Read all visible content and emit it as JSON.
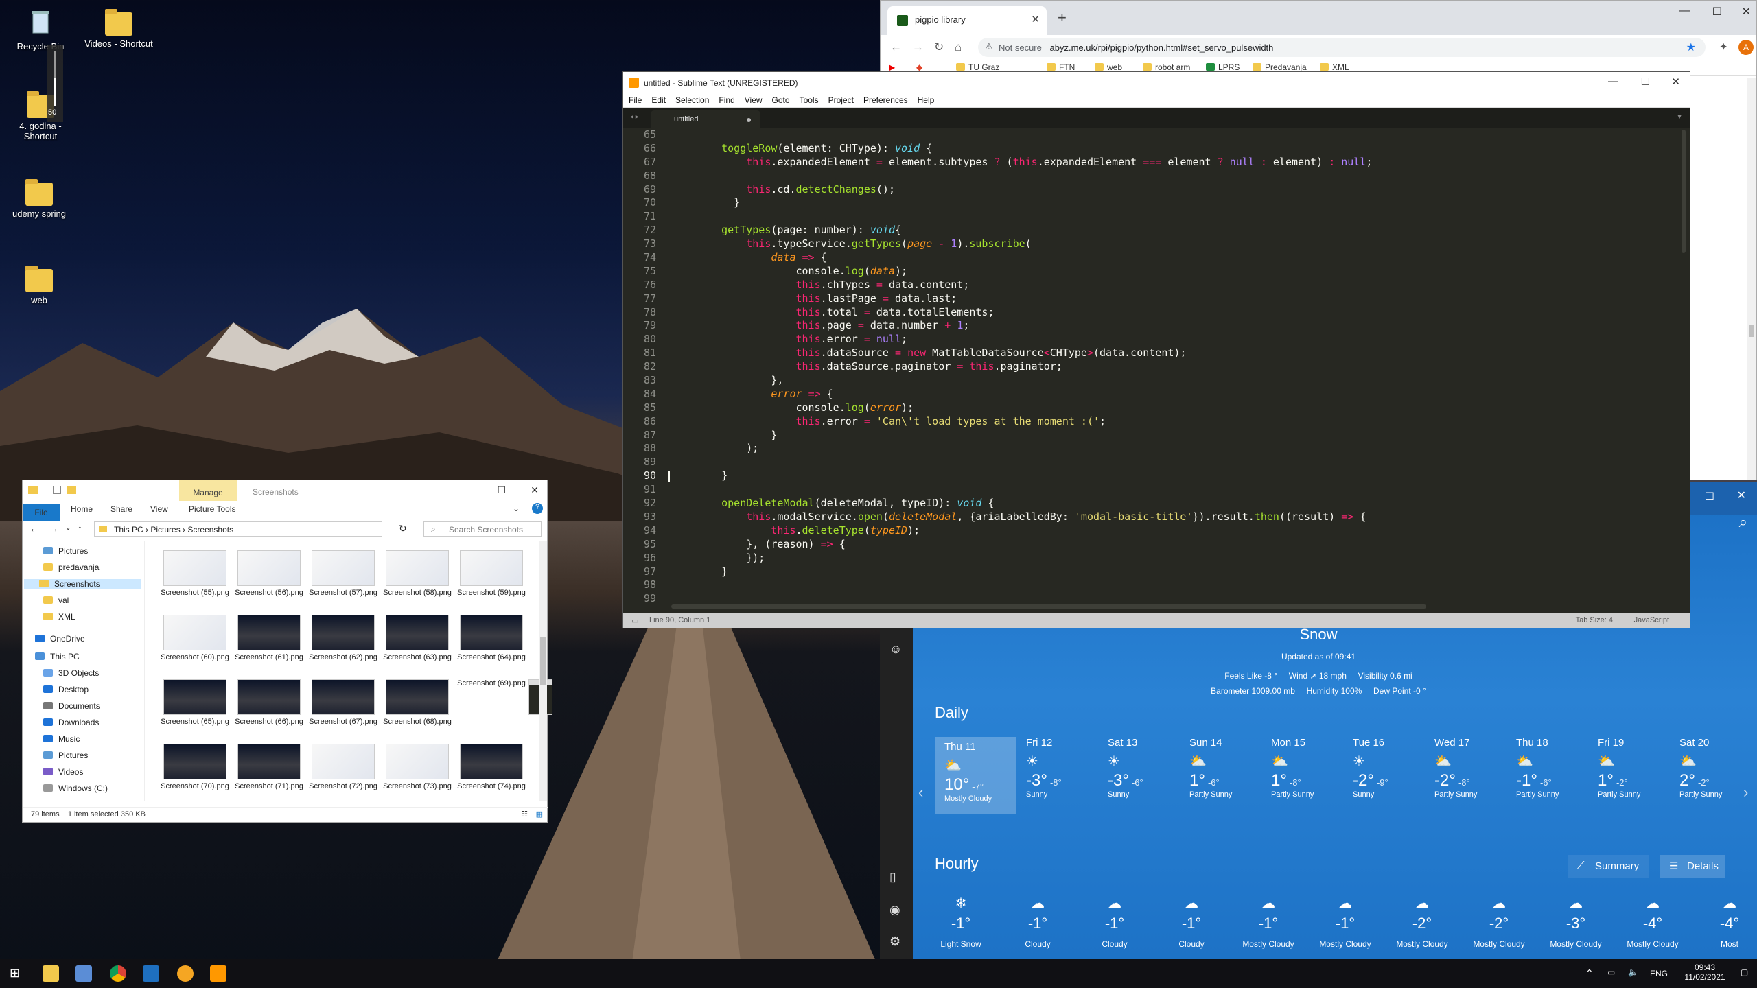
{
  "desktop": {
    "icons": [
      {
        "label": "Recycle Bin"
      },
      {
        "label": "Videos - Shortcut"
      },
      {
        "label": "4. godina - Shortcut"
      },
      {
        "label": "udemy spring"
      },
      {
        "label": "web"
      }
    ],
    "volume_level": "50"
  },
  "chrome": {
    "tab_title": "pigpio library",
    "url_prefix": "Not secure",
    "url": "abyz.me.uk/rpi/pigpio/python.html#set_servo_pulsewidth",
    "profile_initial": "A",
    "bookmarks": [
      "TU Graz",
      "FTN",
      "web",
      "robot arm",
      "LPRS",
      "Predavanja",
      "XML"
    ]
  },
  "sublime": {
    "window_title": "untitled - Sublime Text (UNREGISTERED)",
    "menu": [
      "File",
      "Edit",
      "Selection",
      "Find",
      "View",
      "Goto",
      "Tools",
      "Project",
      "Preferences",
      "Help"
    ],
    "tab_name": "untitled",
    "line_numbers": [
      "65",
      "66",
      "67",
      "68",
      "69",
      "70",
      "71",
      "72",
      "73",
      "74",
      "75",
      "76",
      "77",
      "78",
      "79",
      "80",
      "81",
      "82",
      "83",
      "84",
      "85",
      "86",
      "87",
      "88",
      "89",
      "90",
      "91",
      "92",
      "93",
      "94",
      "95",
      "96",
      "97",
      "98",
      "99"
    ],
    "status_left": "Line 90, Column 1",
    "tab_size": "Tab Size: 4",
    "syntax": "JavaScript"
  },
  "explorer": {
    "manage_tab": "Manage",
    "title": "Screenshots",
    "ribbon": [
      "File",
      "Home",
      "Share",
      "View",
      "Picture Tools"
    ],
    "path": [
      "This PC",
      "Pictures",
      "Screenshots"
    ],
    "search_placeholder": "Search Screenshots",
    "nav": [
      "Pictures",
      "predavanja",
      "Screenshots",
      "val",
      "XML",
      "OneDrive",
      "This PC",
      "3D Objects",
      "Desktop",
      "Documents",
      "Downloads",
      "Music",
      "Pictures",
      "Videos",
      "Windows (C:)"
    ],
    "thumbs": [
      {
        "label": "Screenshot (55).png",
        "style": "light"
      },
      {
        "label": "Screenshot (56).png",
        "style": "light"
      },
      {
        "label": "Screenshot (57).png",
        "style": "light"
      },
      {
        "label": "Screenshot (58).png",
        "style": "light"
      },
      {
        "label": "Screenshot (59).png",
        "style": "light"
      },
      {
        "label": "Screenshot (60).png",
        "style": "light"
      },
      {
        "label": "Screenshot (61).png",
        "style": "dark"
      },
      {
        "label": "Screenshot (62).png",
        "style": "dark"
      },
      {
        "label": "Screenshot (63).png",
        "style": "dark"
      },
      {
        "label": "Screenshot (64).png",
        "style": "dark"
      },
      {
        "label": "Screenshot (65).png",
        "style": "dark"
      },
      {
        "label": "Screenshot (66).png",
        "style": "dark"
      },
      {
        "label": "Screenshot (67).png",
        "style": "dark"
      },
      {
        "label": "Screenshot (68).png",
        "style": "dark"
      },
      {
        "label": "Screenshot (69).png",
        "style": "code"
      },
      {
        "label": "Screenshot (70).png",
        "style": "dark"
      },
      {
        "label": "Screenshot (71).png",
        "style": "dark"
      },
      {
        "label": "Screenshot (72).png",
        "style": "light"
      },
      {
        "label": "Screenshot (73).png",
        "style": "light"
      },
      {
        "label": "Screenshot (74).png",
        "style": "dark"
      }
    ],
    "status_items": "79 items",
    "status_selected": "1 item selected  350 KB"
  },
  "weather": {
    "condition": "Snow",
    "updated": "Updated as of 09:41",
    "feels_like_label": "Feels Like",
    "feels_like": "-8 °",
    "wind_label": "Wind",
    "wind": "18 mph",
    "visibility_label": "Visibility",
    "visibility": "0.6 mi",
    "barometer_label": "Barometer",
    "barometer": "1009.00 mb",
    "humidity_label": "Humidity",
    "humidity": "100%",
    "dewpoint_label": "Dew Point",
    "dewpoint": "-0 °",
    "daily_heading": "Daily",
    "days": [
      {
        "day": "Thu 11",
        "hi": "10°",
        "lo": "-7°",
        "desc": "Mostly Cloudy",
        "icon": "partly-cloudy-icon"
      },
      {
        "day": "Fri 12",
        "hi": "-3°",
        "lo": "-8°",
        "desc": "Sunny",
        "icon": "sun-icon"
      },
      {
        "day": "Sat 13",
        "hi": "-3°",
        "lo": "-6°",
        "desc": "Sunny",
        "icon": "sun-icon"
      },
      {
        "day": "Sun 14",
        "hi": "1°",
        "lo": "-6°",
        "desc": "Partly Sunny",
        "icon": "partly-sunny-icon"
      },
      {
        "day": "Mon 15",
        "hi": "1°",
        "lo": "-8°",
        "desc": "Partly Sunny",
        "icon": "partly-sunny-icon"
      },
      {
        "day": "Tue 16",
        "hi": "-2°",
        "lo": "-9°",
        "desc": "Sunny",
        "icon": "sun-icon"
      },
      {
        "day": "Wed 17",
        "hi": "-2°",
        "lo": "-8°",
        "desc": "Partly Sunny",
        "icon": "partly-sunny-icon"
      },
      {
        "day": "Thu 18",
        "hi": "-1°",
        "lo": "-6°",
        "desc": "Partly Sunny",
        "icon": "partly-sunny-icon"
      },
      {
        "day": "Fri 19",
        "hi": "1°",
        "lo": "-2°",
        "desc": "Partly Sunny",
        "icon": "partly-sunny-icon"
      },
      {
        "day": "Sat 20",
        "hi": "2°",
        "lo": "-2°",
        "desc": "Partly Sunny",
        "icon": "partly-sunny-icon"
      }
    ],
    "hourly_heading": "Hourly",
    "summary_btn": "Summary",
    "details_btn": "Details",
    "hours": [
      {
        "tp": "-1°",
        "desc": "Light Snow"
      },
      {
        "tp": "-1°",
        "desc": "Cloudy"
      },
      {
        "tp": "-1°",
        "desc": "Cloudy"
      },
      {
        "tp": "-1°",
        "desc": "Cloudy"
      },
      {
        "tp": "-1°",
        "desc": "Mostly Cloudy"
      },
      {
        "tp": "-1°",
        "desc": "Mostly Cloudy"
      },
      {
        "tp": "-2°",
        "desc": "Mostly Cloudy"
      },
      {
        "tp": "-2°",
        "desc": "Mostly Cloudy"
      },
      {
        "tp": "-3°",
        "desc": "Mostly Cloudy"
      },
      {
        "tp": "-4°",
        "desc": "Mostly Cloudy"
      },
      {
        "tp": "-4°",
        "desc": "Most"
      }
    ]
  },
  "taskbar": {
    "lang": "ENG",
    "time": "09:43",
    "date": "11/02/2021"
  }
}
